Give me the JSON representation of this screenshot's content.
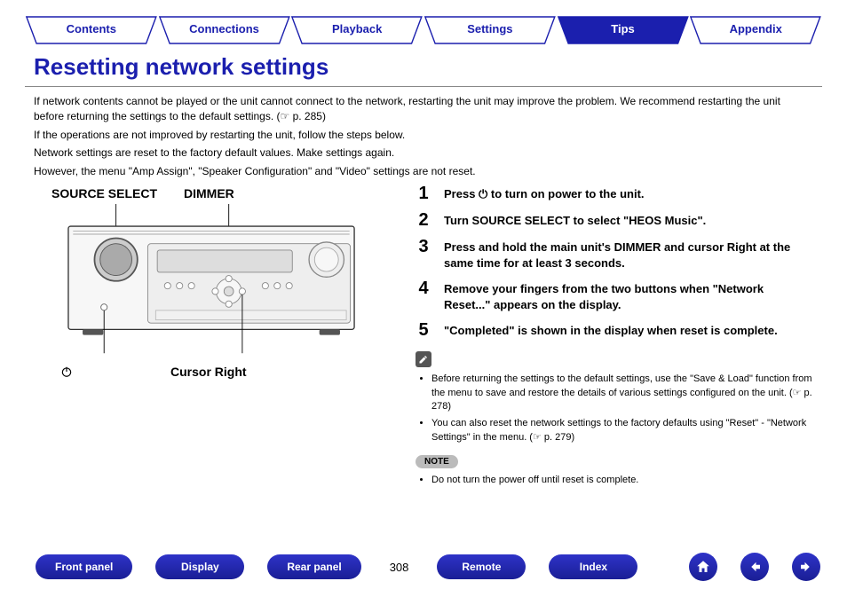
{
  "nav": {
    "tabs": [
      "Contents",
      "Connections",
      "Playback",
      "Settings",
      "Tips",
      "Appendix"
    ],
    "active_index": 4
  },
  "title": "Resetting network settings",
  "intro": [
    "If network contents cannot be played or the unit cannot connect to the network, restarting the unit may improve the problem. We recommend restarting the unit before returning the settings to the default settings. (☞ p. 285)",
    "If the operations are not improved by restarting the unit, follow the steps below.",
    "Network settings are reset to the factory default values. Make settings again.",
    "However, the menu \"Amp Assign\", \"Speaker Configuration\" and \"Video\" settings are not reset."
  ],
  "diagram": {
    "top_labels": {
      "source_select": "SOURCE SELECT",
      "dimmer": "DIMMER"
    },
    "bottom_labels": {
      "power": "power-icon",
      "cursor_right": "Cursor Right"
    }
  },
  "steps": [
    "Press ⏻ to turn on power to the unit.",
    "Turn SOURCE SELECT to select \"HEOS Music\".",
    "Press and hold the main unit's DIMMER and cursor Right at the same time for at least 3 seconds.",
    "Remove your fingers from the two buttons when \"Network Reset...\" appears on the display.",
    "\"Completed\" is shown in the display when reset is complete."
  ],
  "tips": [
    "Before returning the settings to the default settings, use the \"Save & Load\" function from the menu to save and restore the details of various settings configured on the unit. (☞ p. 278)",
    "You can also reset the network settings to the factory defaults using \"Reset\" - \"Network Settings\" in the menu. (☞ p. 279)"
  ],
  "note_label": "NOTE",
  "notes": [
    "Do not turn the power off until reset is complete."
  ],
  "footer": {
    "buttons": [
      "Front panel",
      "Display",
      "Rear panel"
    ],
    "page": "308",
    "buttons_right": [
      "Remote",
      "Index"
    ]
  }
}
